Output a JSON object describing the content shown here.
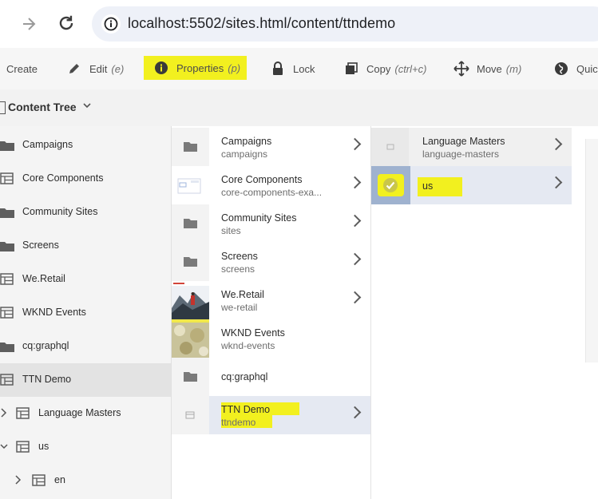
{
  "browser": {
    "url": "localhost:5502/sites.html/content/ttndemo"
  },
  "actions": [
    {
      "label": "Create",
      "shortcut": "",
      "icon": "create-icon"
    },
    {
      "label": "Edit",
      "shortcut": "(e)",
      "icon": "pencil-icon"
    },
    {
      "label": "Properties",
      "shortcut": "(p)",
      "icon": "info-icon"
    },
    {
      "label": "Lock",
      "shortcut": "",
      "icon": "lock-icon"
    },
    {
      "label": "Copy",
      "shortcut": "(ctrl+c)",
      "icon": "copy-icon"
    },
    {
      "label": "Move",
      "shortcut": "(m)",
      "icon": "move-icon"
    },
    {
      "label": "Quick",
      "shortcut": "",
      "icon": "globe-icon"
    }
  ],
  "highlight_color": "#f2f01f",
  "tree": {
    "title": "Content Tree",
    "items": [
      {
        "label": "Campaigns",
        "icon": "folder-icon"
      },
      {
        "label": "Core Components",
        "icon": "page-icon"
      },
      {
        "label": "Community Sites",
        "icon": "folder-icon"
      },
      {
        "label": "Screens",
        "icon": "folder-icon"
      },
      {
        "label": "We.Retail",
        "icon": "page-icon"
      },
      {
        "label": "WKND Events",
        "icon": "page-icon"
      },
      {
        "label": "cq:graphql",
        "icon": "folder-icon"
      },
      {
        "label": "TTN Demo",
        "icon": "page-icon"
      },
      {
        "label": "Language Masters",
        "icon": "page-icon"
      },
      {
        "label": "us",
        "icon": "page-icon"
      },
      {
        "label": "en",
        "icon": "page-icon"
      }
    ]
  },
  "column2": [
    {
      "title": "Campaigns",
      "name": "campaigns",
      "thumb": "folder-icon"
    },
    {
      "title": "Core Components",
      "name": "core-components-exa...",
      "thumb": "page-thumbnail"
    },
    {
      "title": "Community Sites",
      "name": "sites",
      "thumb": "folder-icon"
    },
    {
      "title": "Screens",
      "name": "screens",
      "thumb": "folder-icon"
    },
    {
      "title": "We.Retail",
      "name": "we-retail",
      "thumb": "we-retail-thumbnail"
    },
    {
      "title": "WKND Events",
      "name": "wknd-events",
      "thumb": "wknd-thumbnail"
    },
    {
      "title": "cq:graphql",
      "name": "",
      "thumb": "folder-icon"
    },
    {
      "title": "TTN Demo",
      "name": "ttndemo",
      "thumb": "page-icon"
    }
  ],
  "column3": [
    {
      "title": "Language Masters",
      "name": "language-masters",
      "thumb": "page-icon"
    },
    {
      "title": "us",
      "name": "",
      "thumb": "check-icon"
    }
  ]
}
